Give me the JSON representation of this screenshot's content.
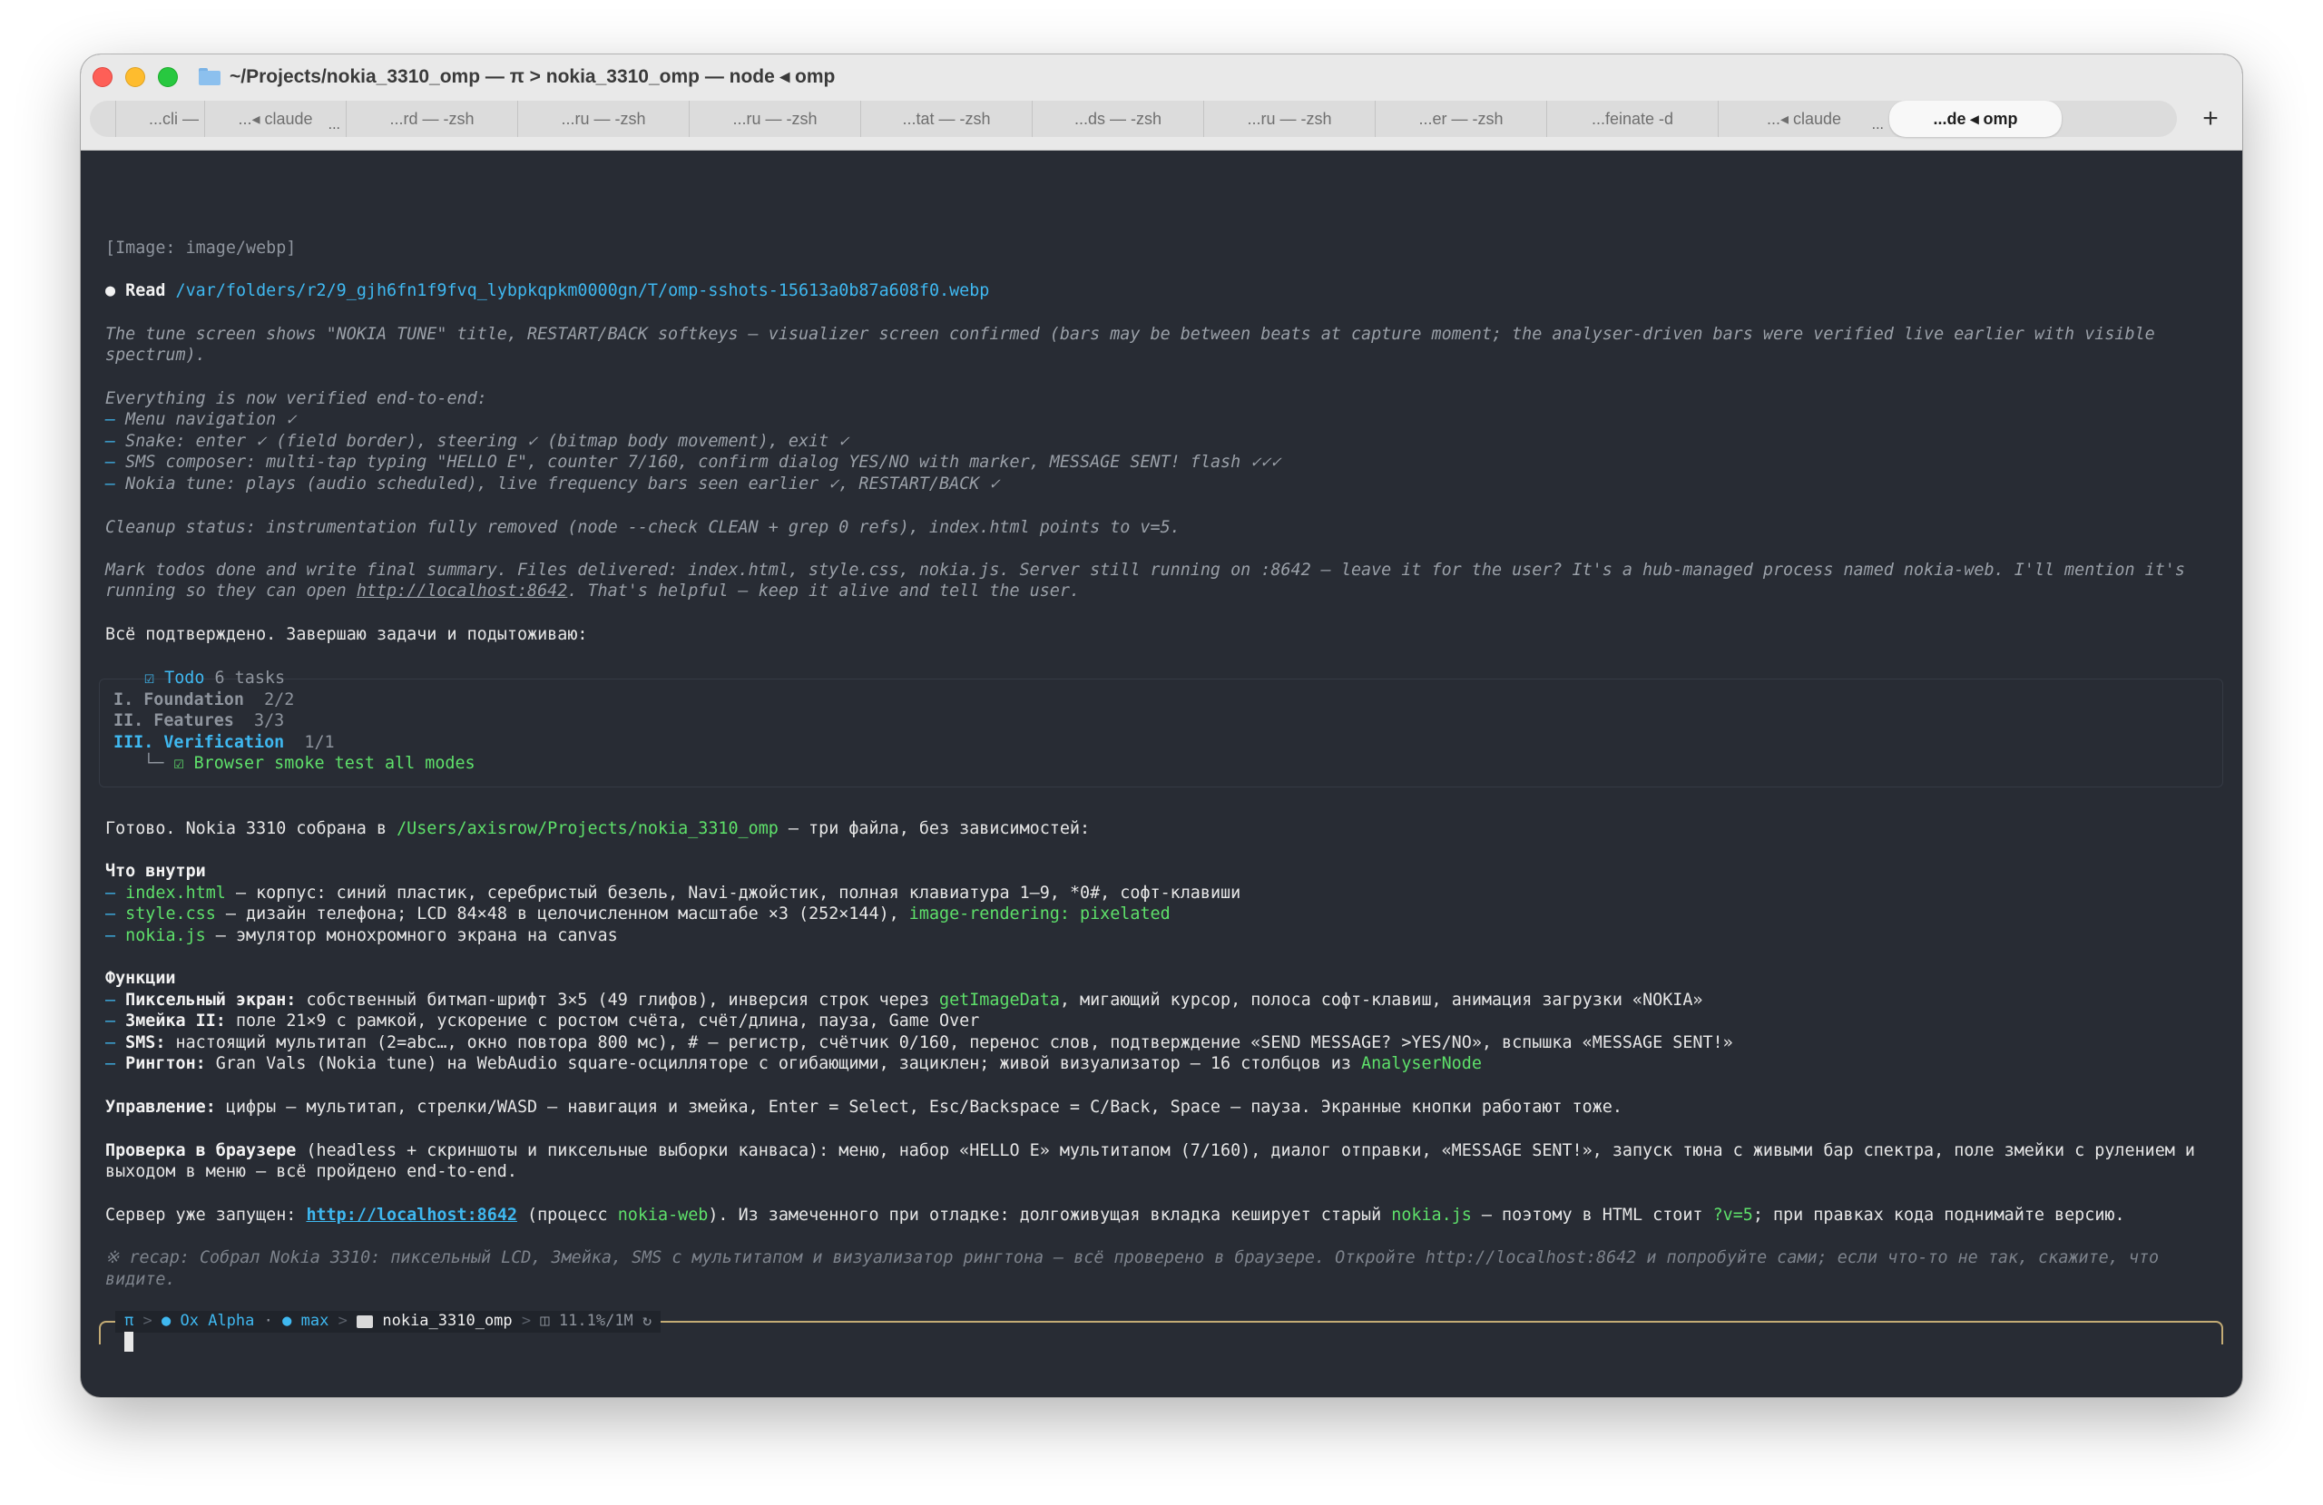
{
  "window": {
    "title": "~/Projects/nokia_3310_omp — π > nokia_3310_omp — node ◂ omp",
    "tabs": [
      {
        "label": ""
      },
      {
        "label": "...cli —"
      },
      {
        "label": "...◂ claude",
        "more": "..."
      },
      {
        "label": "...rd — -zsh"
      },
      {
        "label": "...ru — -zsh"
      },
      {
        "label": "...ru — -zsh"
      },
      {
        "label": "...tat — -zsh"
      },
      {
        "label": "...ds — -zsh"
      },
      {
        "label": "...ru — -zsh"
      },
      {
        "label": "...er — -zsh"
      },
      {
        "label": "...feinate -d"
      },
      {
        "label": "...◂ claude",
        "more": "..."
      },
      {
        "label": "...de ◂ omp",
        "active": true
      }
    ],
    "new_tab": "+"
  },
  "terminal": {
    "image_line": "[Image: image/webp]",
    "read": {
      "bullet": "●",
      "label": "Read",
      "path": "/var/folders/r2/9_gjh6fn1f9fvq_lybpkqpkm0000gn/T/omp-sshots-15613a0b87a608f0.webp"
    },
    "thinking": {
      "p1_l1": "The tune screen shows \"NOKIA TUNE\" title, RESTART/BACK softkeys — visualizer screen confirmed (bars may be between beats at capture moment; the analyser-driven bars were verified live earlier with visible",
      "p1_l2": "spectrum).",
      "p2_head": "Everything is now verified end-to-end:",
      "bullets": [
        "Menu navigation ✓",
        "Snake: enter ✓ (field border), steering ✓ (bitmap body movement), exit ✓",
        "SMS composer: multi-tap typing \"HELLO E\", counter 7/160, confirm dialog YES/NO with marker, MESSAGE SENT! flash ✓✓✓",
        "Nokia tune: plays (audio scheduled), live frequency bars seen earlier ✓, RESTART/BACK ✓"
      ],
      "dash": "–",
      "cleanup": "Cleanup status: instrumentation fully removed (node --check CLEAN + grep 0 refs), index.html points to v=5.",
      "mark_l1": "Mark todos done and write final summary. Files delivered: index.html, style.css, nokia.js. Server still running on :8642 — leave it for the user? It's a hub-managed process named nokia-web. I'll mention it's",
      "mark_l2_pre": "running so they can open ",
      "mark_l2_link": "http://localhost:8642",
      "mark_l2_post": ". That's helpful — keep it alive and tell the user."
    },
    "confirm": "Всё подтверждено. Завершаю задачи и подытоживаю:",
    "todo": {
      "check": "☑",
      "title": "Todo",
      "count": "6 tasks",
      "phases": [
        {
          "name": "I. Foundation",
          "progress": "2/2"
        },
        {
          "name": "II. Features",
          "progress": "3/3"
        },
        {
          "name": "III. Verification",
          "progress": "1/1"
        }
      ],
      "tree": "└─",
      "task": "Browser smoke test all modes"
    },
    "done": {
      "pre": "Готово. Nokia 3310 собрана в ",
      "path": "/Users/axisrow/Projects/nokia_3310_omp",
      "post": " — три файла, без зависимостей:"
    },
    "inside": {
      "heading": "Что внутри",
      "items": [
        {
          "file": "index.html",
          "text": " — корпус: синий пластик, серебристый безель, Navi-джойстик, полная клавиатура 1–9, *0#, софт-клавиши",
          "extra": ""
        },
        {
          "file": "style.css",
          "text": " — дизайн телефона; LCD 84×48 в целочисленном масштабе ×3 (252×144), ",
          "extra": "image-rendering: pixelated"
        },
        {
          "file": "nokia.js",
          "text": " — эмулятор монохромного экрана на canvas",
          "extra": ""
        }
      ]
    },
    "functions": {
      "heading": "Функции",
      "f1_label": "Пиксельный экран:",
      "f1_pre": " собственный битмап-шрифт 3×5 (49 глифов), инверсия строк через ",
      "f1_code": "getImageData",
      "f1_post": ", мигающий курсор, полоса софт-клавиш, анимация загрузки «NOKIA»",
      "f2_label": "Змейка II:",
      "f2_text": " поле 21×9 с рамкой, ускорение с ростом счёта, счёт/длина, пауза, Game Over",
      "f3_label": "SMS:",
      "f3_text": " настоящий мультитап (2=abc…, окно повтора 800 мс), # — регистр, счётчик 0/160, перенос слов, подтверждение «SEND MESSAGE? >YES/NO», вспышка «MESSAGE SENT!»",
      "f4_label": "Рингтон:",
      "f4_pre": " Gran Vals (Nokia tune) на WebAudio square-осцилляторе с огибающими, зациклен; живой визуализатор — 16 столбцов из ",
      "f4_code": "AnalyserNode"
    },
    "controls": {
      "label": "Управление:",
      "text": " цифры — мультитап, стрелки/WASD — навигация и змейка, Enter = Select, Esc/Backspace = C/Back, Space — пауза. Экранные кнопки работают тоже."
    },
    "browser": {
      "label": "Проверка в браузере",
      "l1": " (headless + скриншоты и пиксельные выборки канваса): меню, набор «HELLO E» мультитапом (7/160), диалог отправки, «MESSAGE SENT!», запуск тюна с живыми бар спектра, поле змейки с рулением и",
      "l2": "выходом в меню — всё пройдено end-to-end."
    },
    "server": {
      "pre": "Сервер уже запущен: ",
      "link": "http://localhost:8642",
      "mid1": " (процесс ",
      "proc": "nokia-web",
      "mid2": "). Из замеченного при отладке: долгоживущая вкладка кеширует старый ",
      "file": "nokia.js",
      "mid3": " — поэтому в HTML стоит ",
      "ver": "?v=5",
      "post": "; при правках кода поднимайте версию."
    },
    "recap": {
      "l1": "※ recap: Собрал Nokia 3310: пиксельный LCD, Змейка, SMS с мультитапом и визуализатор рингтона — всё проверено в браузере. Откройте http://localhost:8642 и попробуйте сами; если что-то не так, скажите, что",
      "l2": "видите."
    },
    "status": {
      "pi": "π",
      "arrow": ">",
      "model_dot": "●",
      "model": "Ox Alpha",
      "dot_sep": "·",
      "mode": "max",
      "dir": "nokia_3310_omp",
      "ctx": "11.1%/1M",
      "ctx_icon": "◫",
      "loop_icon": "↻"
    }
  }
}
